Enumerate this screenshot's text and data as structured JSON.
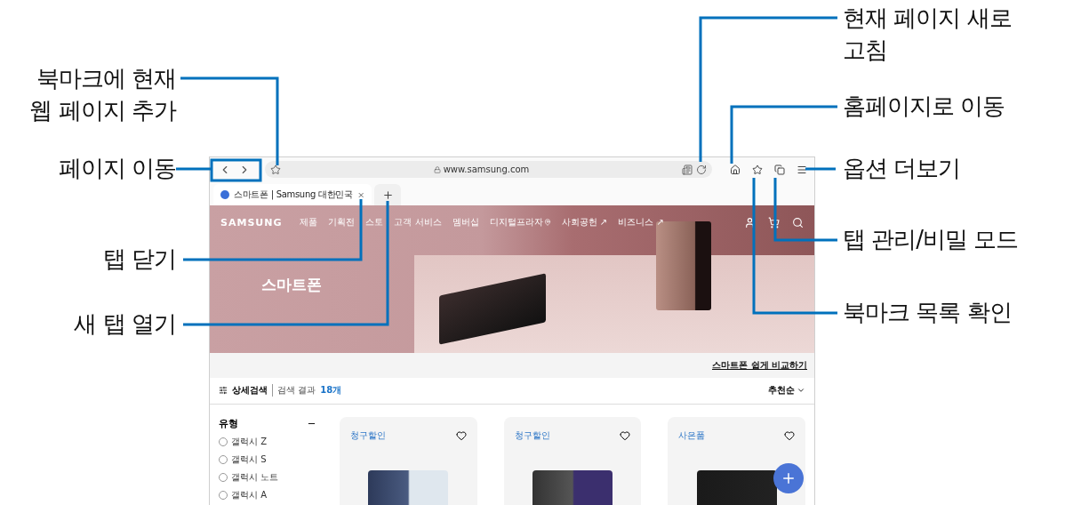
{
  "callouts_left": [
    {
      "text": "북마크에 현재\n웹 페이지 추가"
    },
    {
      "text": "페이지 이동"
    },
    {
      "text": "탭 닫기"
    },
    {
      "text": "새 탭 열기"
    }
  ],
  "callouts_right": [
    {
      "text": "현재 페이지 새로\n고침"
    },
    {
      "text": "홈페이지로 이동"
    },
    {
      "text": "옵션 더보기"
    },
    {
      "text": "탭 관리/비밀 모드"
    },
    {
      "text": "북마크 목록 확인"
    }
  ],
  "browser": {
    "address": "www.samsung.com",
    "tabs": [
      {
        "title": "스마트폰 | Samsung 대한민국",
        "selected": true
      }
    ],
    "site": {
      "logo": "SAMSUNG",
      "menu": [
        {
          "label": "제품"
        },
        {
          "label": "기획전"
        },
        {
          "label": "스토"
        },
        {
          "label": "고객 서비스"
        },
        {
          "label": "멤버십"
        },
        {
          "label": "디지털프라자",
          "kind": "pin"
        },
        {
          "label": "사회공헌 ↗"
        },
        {
          "label": "비즈니스 ↗"
        }
      ],
      "hero_title": "스마트폰",
      "compare_link": "스마트폰 쉽게 비교하기",
      "filter": {
        "label": "상세검색",
        "result_label": "검색 결과",
        "count": "18개",
        "sort": "추천순"
      },
      "sidebar": {
        "heading": "유형",
        "options": [
          {
            "label": "갤럭시 Z",
            "selected": false
          },
          {
            "label": "갤럭시 S",
            "selected": false
          },
          {
            "label": "갤럭시 노트",
            "selected": false
          },
          {
            "label": "갤럭시 A",
            "selected": false
          }
        ]
      },
      "cards": [
        {
          "tag": "청구할인"
        },
        {
          "tag": "청구할인"
        },
        {
          "tag": "사은품"
        }
      ]
    }
  }
}
